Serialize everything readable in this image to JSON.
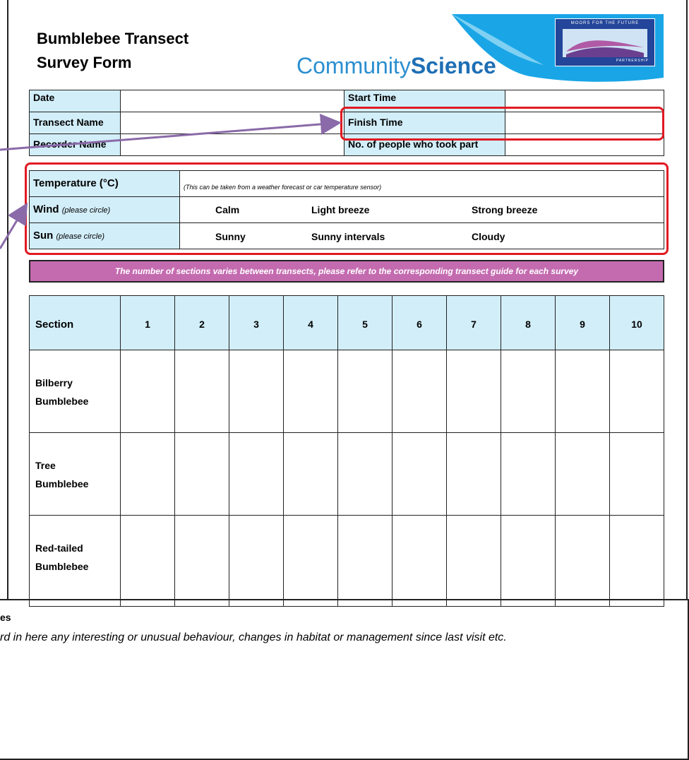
{
  "header": {
    "title_line1": "Bumblebee Transect",
    "title_line2": "Survey Form",
    "brand_part1": "Community",
    "brand_part2": "Science",
    "logo_top_text": "MOORS FOR THE FUTURE",
    "logo_bottom_text": "PARTNERSHIP"
  },
  "info_table": {
    "date": "Date",
    "transect_name": "Transect Name",
    "recorder_name": "Recorder Name",
    "start_time": "Start Time",
    "finish_time": "Finish Time",
    "people": "No. of people who took part"
  },
  "weather": {
    "temperature_label": "Temperature (°C)",
    "temperature_note": "(This can be taken from a weather forecast or car temperature sensor)",
    "wind_label": "Wind",
    "wind_hint": "(please circle)",
    "wind_options": [
      "Calm",
      "Light breeze",
      "Strong breeze"
    ],
    "sun_label": "Sun",
    "sun_hint": "(please circle)",
    "sun_options": [
      "Sunny",
      "Sunny intervals",
      "Cloudy"
    ]
  },
  "banner": "The number of sections varies between transects, please refer to the corresponding transect guide for each survey",
  "sections_table": {
    "header": "Section",
    "columns": [
      "1",
      "2",
      "3",
      "4",
      "5",
      "6",
      "7",
      "8",
      "9",
      "10"
    ],
    "rows": [
      {
        "line1": "Bilberry",
        "line2": "Bumblebee"
      },
      {
        "line1": "Tree",
        "line2": "Bumblebee"
      },
      {
        "line1": "Red-tailed",
        "line2": "Bumblebee"
      }
    ]
  },
  "notes": {
    "label": "es",
    "text": "rd in here any interesting or unusual behaviour, changes in habitat or management since last visit etc."
  },
  "colors": {
    "light_blue": "#d2eef9",
    "banner_purple": "#c46bb0",
    "highlight_red": "#e11a22",
    "arrow_purple": "#8a6aa8",
    "brand_blue": "#2b8fd0",
    "brand_dark": "#1e6fb5"
  }
}
